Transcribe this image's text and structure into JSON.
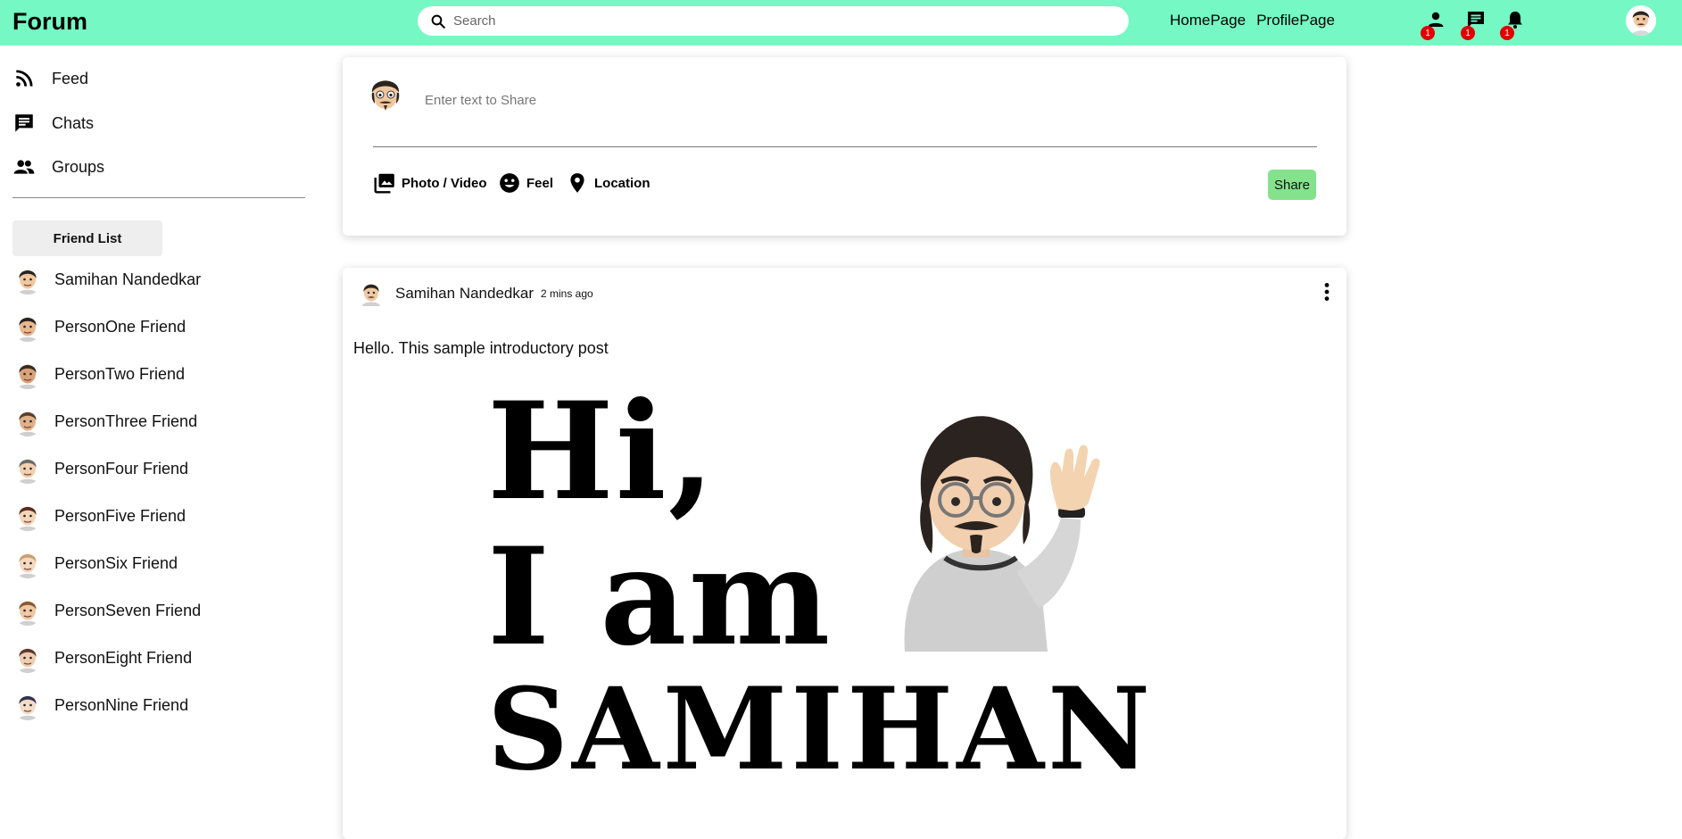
{
  "header": {
    "logo": "Forum",
    "search_placeholder": "Search",
    "nav": [
      "HomePage",
      "ProfilePage"
    ],
    "notifications": {
      "friends_count": "1",
      "messages_count": "1",
      "alerts_count": "1"
    },
    "accent_color": "#75f8c3"
  },
  "sidebar": {
    "items": [
      {
        "label": "Feed",
        "icon": "rss-feed-icon"
      },
      {
        "label": "Chats",
        "icon": "chat-icon"
      },
      {
        "label": "Groups",
        "icon": "group-icon"
      }
    ],
    "friend_list_button": "Friend List",
    "friends": [
      "Samihan Nandedkar",
      "PersonOne Friend",
      "PersonTwo Friend",
      "PersonThree Friend",
      "PersonFour Friend",
      "PersonFive Friend",
      "PersonSix Friend",
      "PersonSeven Friend",
      "PersonEight Friend",
      "PersonNine Friend"
    ]
  },
  "share": {
    "placeholder": "Enter text to Share",
    "options": [
      "Photo / Video",
      "Feel",
      "Location"
    ],
    "share_button": "Share",
    "share_button_color": "#84e28c"
  },
  "post": {
    "author": "Samihan Nandedkar",
    "time": "2 mins ago",
    "text": "Hello. This sample introductory post",
    "image_text": [
      "Hi,",
      "I am",
      "SAMIHAN"
    ]
  }
}
